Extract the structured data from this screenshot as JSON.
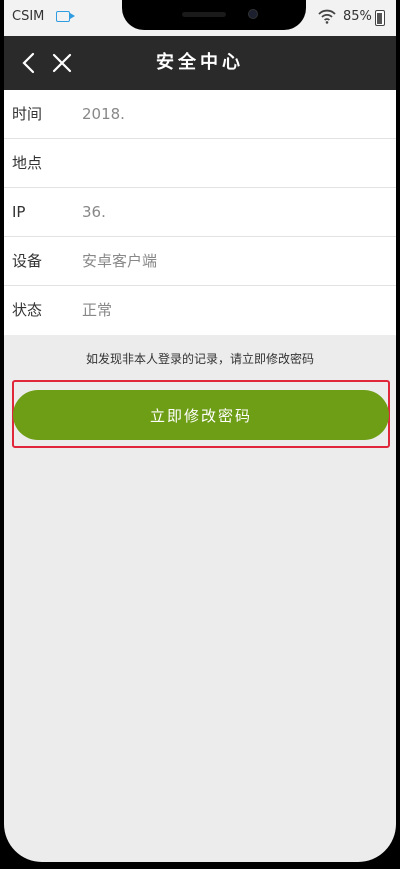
{
  "status_bar": {
    "carrier": "CSIM",
    "battery": "85%",
    "cast_icon": "screen-cast-icon",
    "wifi_icon": "wifi-icon",
    "battery_icon": "battery-icon"
  },
  "header": {
    "title": "安全中心",
    "back_icon": "chevron-left-icon",
    "close_icon": "close-icon"
  },
  "info": {
    "rows": [
      {
        "label": "时间",
        "value": "2018."
      },
      {
        "label": "地点",
        "value": ""
      },
      {
        "label": "IP",
        "value": "36."
      },
      {
        "label": "设备",
        "value": "安卓客户端"
      },
      {
        "label": "状态",
        "value": "正常"
      }
    ]
  },
  "notice": "如发现非本人登录的记录，请立即修改密码",
  "action": {
    "label": "立即修改密码"
  },
  "colors": {
    "accent_green": "#6e9e16",
    "title_bar": "#2a2a2a",
    "highlight_red": "#e0263a"
  }
}
